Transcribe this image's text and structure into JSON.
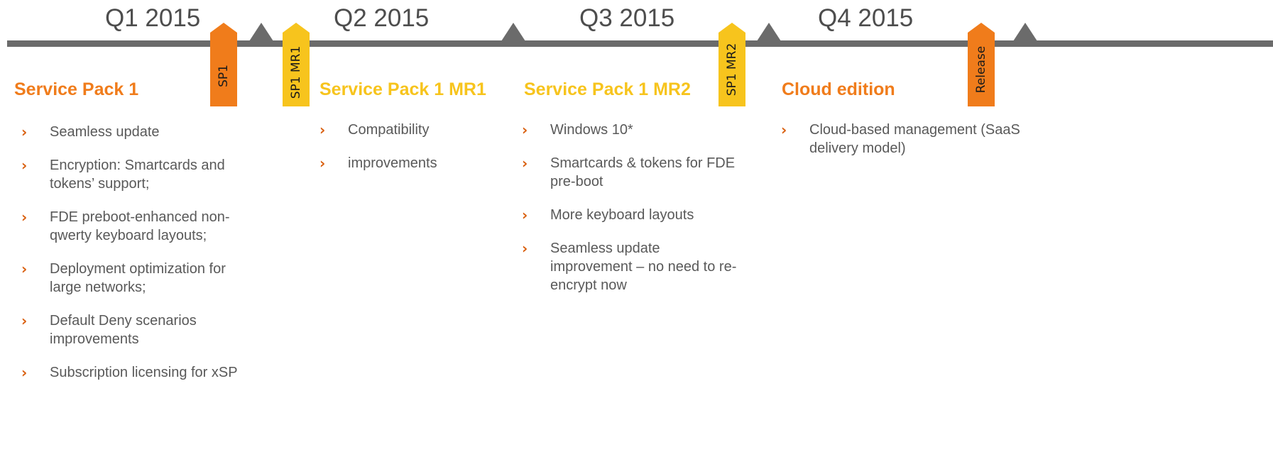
{
  "colors": {
    "orange": "#f07c1b",
    "yellow": "#f7c41d",
    "timeline": "#6b6b6b",
    "bullet": "#d95f0e",
    "text": "#595959"
  },
  "quarters": [
    "Q1 2015",
    "Q2 2015",
    "Q3 2015",
    "Q4 2015"
  ],
  "flags": [
    "SP1",
    "SP1 MR1",
    "SP1 MR2",
    "Release"
  ],
  "columns": [
    {
      "heading": "Service Pack 1",
      "items": [
        "Seamless update",
        "Encryption: Smartcards and tokens’ support;",
        "FDE preboot-enhanced non-qwerty keyboard layouts;",
        "Deployment optimization for large networks;",
        "Default Deny scenarios improvements",
        "Subscription licensing for xSP"
      ]
    },
    {
      "heading": "Service Pack 1 MR1",
      "items": [
        "Compatibility",
        "improvements"
      ]
    },
    {
      "heading": "Service Pack 1 MR2",
      "items": [
        "Windows 10*",
        "Smartcards & tokens for FDE pre-boot",
        "More keyboard layouts",
        "Seamless update improvement – no need to re-encrypt now"
      ]
    },
    {
      "heading": "Cloud edition",
      "items": [
        "Cloud-based management (SaaS delivery model)"
      ]
    }
  ],
  "bullet_glyph": "›"
}
